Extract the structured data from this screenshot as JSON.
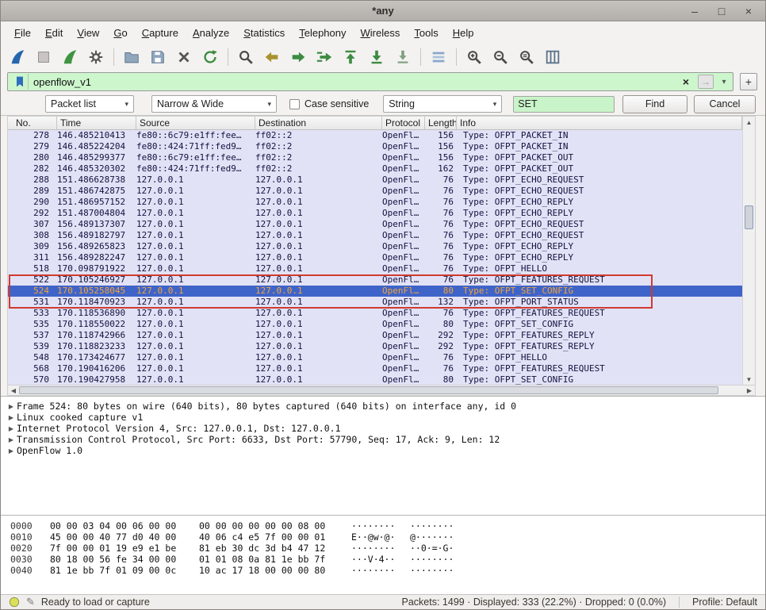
{
  "window": {
    "title": "*any",
    "controls": {
      "minimize": "–",
      "maximize": "□",
      "close": "×"
    }
  },
  "menu": [
    "File",
    "Edit",
    "View",
    "Go",
    "Capture",
    "Analyze",
    "Statistics",
    "Telephony",
    "Wireless",
    "Tools",
    "Help"
  ],
  "toolbar": {
    "buttons": [
      "start-capture",
      "stop-capture",
      "restart-capture",
      "capture-options",
      "open-file",
      "save-file",
      "close-file",
      "reload-file",
      "find-packet",
      "go-back",
      "go-forward",
      "go-to-packet",
      "go-to-top",
      "go-to-bottom",
      "auto-scroll",
      "colorize-packets",
      "zoom-in",
      "zoom-out",
      "zoom-reset",
      "resize-columns"
    ]
  },
  "filter": {
    "value": "openflow_v1",
    "clear_glyph": "×",
    "apply_glyph": "→",
    "caret_glyph": "▾",
    "add_label": "+"
  },
  "find_bar": {
    "scope": "Packet list",
    "charset": "Narrow & Wide",
    "case_label": "Case sensitive",
    "type": "String",
    "query": "SET",
    "find_label": "Find",
    "cancel_label": "Cancel"
  },
  "packet_list": {
    "columns": [
      "No.",
      "Time",
      "Source",
      "Destination",
      "Protocol",
      "Length",
      "Info"
    ],
    "selected_no": "524",
    "annotated_rows": [
      "522",
      "524",
      "531"
    ],
    "rows": [
      [
        "278",
        "146.485210413",
        "fe80::6c79:e1ff:fee…",
        "ff02::2",
        "OpenFl…",
        "156",
        "Type: OFPT_PACKET_IN"
      ],
      [
        "279",
        "146.485224204",
        "fe80::424:71ff:fed9…",
        "ff02::2",
        "OpenFl…",
        "156",
        "Type: OFPT_PACKET_IN"
      ],
      [
        "280",
        "146.485299377",
        "fe80::6c79:e1ff:fee…",
        "ff02::2",
        "OpenFl…",
        "156",
        "Type: OFPT_PACKET_OUT"
      ],
      [
        "282",
        "146.485320302",
        "fe80::424:71ff:fed9…",
        "ff02::2",
        "OpenFl…",
        "162",
        "Type: OFPT_PACKET_OUT"
      ],
      [
        "288",
        "151.486628738",
        "127.0.0.1",
        "127.0.0.1",
        "OpenFl…",
        "76",
        "Type: OFPT_ECHO_REQUEST"
      ],
      [
        "289",
        "151.486742875",
        "127.0.0.1",
        "127.0.0.1",
        "OpenFl…",
        "76",
        "Type: OFPT_ECHO_REQUEST"
      ],
      [
        "290",
        "151.486957152",
        "127.0.0.1",
        "127.0.0.1",
        "OpenFl…",
        "76",
        "Type: OFPT_ECHO_REPLY"
      ],
      [
        "292",
        "151.487004804",
        "127.0.0.1",
        "127.0.0.1",
        "OpenFl…",
        "76",
        "Type: OFPT_ECHO_REPLY"
      ],
      [
        "307",
        "156.489137307",
        "127.0.0.1",
        "127.0.0.1",
        "OpenFl…",
        "76",
        "Type: OFPT_ECHO_REQUEST"
      ],
      [
        "308",
        "156.489182797",
        "127.0.0.1",
        "127.0.0.1",
        "OpenFl…",
        "76",
        "Type: OFPT_ECHO_REQUEST"
      ],
      [
        "309",
        "156.489265823",
        "127.0.0.1",
        "127.0.0.1",
        "OpenFl…",
        "76",
        "Type: OFPT_ECHO_REPLY"
      ],
      [
        "311",
        "156.489282247",
        "127.0.0.1",
        "127.0.0.1",
        "OpenFl…",
        "76",
        "Type: OFPT_ECHO_REPLY"
      ],
      [
        "518",
        "170.098791922",
        "127.0.0.1",
        "127.0.0.1",
        "OpenFl…",
        "76",
        "Type: OFPT_HELLO"
      ],
      [
        "522",
        "170.105246927",
        "127.0.0.1",
        "127.0.0.1",
        "OpenFl…",
        "76",
        "Type: OFPT_FEATURES_REQUEST"
      ],
      [
        "524",
        "170.105258045",
        "127.0.0.1",
        "127.0.0.1",
        "OpenFl…",
        "80",
        "Type: OFPT_SET_CONFIG"
      ],
      [
        "531",
        "170.118470923",
        "127.0.0.1",
        "127.0.0.1",
        "OpenFl…",
        "132",
        "Type: OFPT_PORT_STATUS"
      ],
      [
        "533",
        "170.118536890",
        "127.0.0.1",
        "127.0.0.1",
        "OpenFl…",
        "76",
        "Type: OFPT_FEATURES_REQUEST"
      ],
      [
        "535",
        "170.118550022",
        "127.0.0.1",
        "127.0.0.1",
        "OpenFl…",
        "80",
        "Type: OFPT_SET_CONFIG"
      ],
      [
        "537",
        "170.118742966",
        "127.0.0.1",
        "127.0.0.1",
        "OpenFl…",
        "292",
        "Type: OFPT_FEATURES_REPLY"
      ],
      [
        "539",
        "170.118823233",
        "127.0.0.1",
        "127.0.0.1",
        "OpenFl…",
        "292",
        "Type: OFPT_FEATURES_REPLY"
      ],
      [
        "548",
        "170.173424677",
        "127.0.0.1",
        "127.0.0.1",
        "OpenFl…",
        "76",
        "Type: OFPT_HELLO"
      ],
      [
        "568",
        "170.190416206",
        "127.0.0.1",
        "127.0.0.1",
        "OpenFl…",
        "76",
        "Type: OFPT_FEATURES_REQUEST"
      ],
      [
        "570",
        "170.190427958",
        "127.0.0.1",
        "127.0.0.1",
        "OpenFl…",
        "80",
        "Type: OFPT_SET_CONFIG"
      ]
    ]
  },
  "details": [
    "Frame 524: 80 bytes on wire (640 bits), 80 bytes captured (640 bits) on interface any, id 0",
    "Linux cooked capture v1",
    "Internet Protocol Version 4, Src: 127.0.0.1, Dst: 127.0.0.1",
    "Transmission Control Protocol, Src Port: 6633, Dst Port: 57790, Seq: 17, Ack: 9, Len: 12",
    "OpenFlow 1.0"
  ],
  "hex_dump": [
    {
      "offset": "0000",
      "hex1": "00 00 03 04 00 06 00 00",
      "hex2": "00 00 00 00 00 00 08 00",
      "ascii1": "········",
      "ascii2": "········"
    },
    {
      "offset": "0010",
      "hex1": "45 00 00 40 77 d0 40 00",
      "hex2": "40 06 c4 e5 7f 00 00 01",
      "ascii1": "E··@w·@·",
      "ascii2": "@·······"
    },
    {
      "offset": "0020",
      "hex1": "7f 00 00 01 19 e9 e1 be",
      "hex2": "81 eb 30 dc 3d b4 47 12",
      "ascii1": "········",
      "ascii2": "··0·=·G·"
    },
    {
      "offset": "0030",
      "hex1": "80 18 00 56 fe 34 00 00",
      "hex2": "01 01 08 0a 81 1e bb 7f",
      "ascii1": "···V·4··",
      "ascii2": "········"
    },
    {
      "offset": "0040",
      "hex1": "81 1e bb 7f 01 09 00 0c",
      "hex2": "10 ac 17 18 00 00 00 80",
      "ascii1": "········",
      "ascii2": "········"
    }
  ],
  "status_bar": {
    "ready_text": "Ready to load or capture",
    "packets_text": "Packets: 1499 · Displayed: 333 (22.2%) · Dropped: 0 (0.0%)",
    "profile_text": "Profile: Default"
  }
}
